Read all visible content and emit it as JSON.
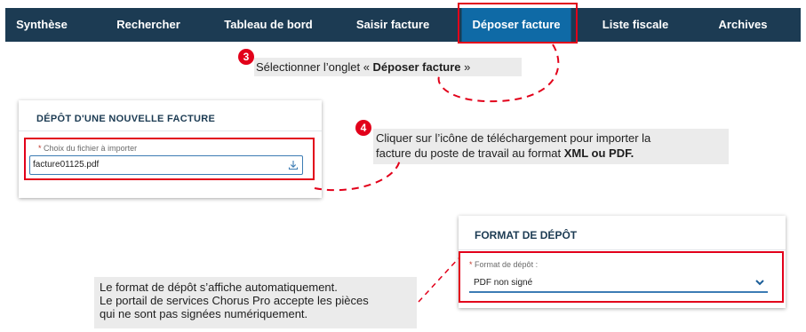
{
  "nav": {
    "tabs": [
      {
        "label": "Synthèse"
      },
      {
        "label": "Rechercher"
      },
      {
        "label": "Tableau de bord"
      },
      {
        "label": "Saisir facture"
      },
      {
        "label": "Déposer facture"
      },
      {
        "label": "Liste fiscale"
      },
      {
        "label": "Archives"
      }
    ],
    "active_tab": "Déposer facture"
  },
  "steps": {
    "step3": {
      "number": "3",
      "text_before": "Sélectionner l’onglet « ",
      "text_bold": "Déposer facture",
      "text_after": " »"
    },
    "step4": {
      "number": "4",
      "line1": "Cliquer sur l’icône de téléchargement pour importer la",
      "line2_before": "facture du poste de travail au format ",
      "line2_bold": "XML ou PDF."
    }
  },
  "upload_panel": {
    "title": "Dépôt d'une nouvelle facture",
    "field_required_mark": "*",
    "field_label": "Choix du fichier à importer",
    "file_value": "facture01125.pdf",
    "icon": "upload-icon"
  },
  "format_panel": {
    "title": "Format de dépôt",
    "field_required_mark": "*",
    "field_label": "Format de dépôt :",
    "selected_value": "PDF non signé",
    "icon": "chevron-down-icon"
  },
  "info": {
    "line1": "Le format de dépôt s’affiche automatiquement.",
    "line2": "Le portail de services Chorus Pro accepte les pièces",
    "line3": "qui ne sont pas signées numériquement."
  },
  "colors": {
    "navbar": "#1c3b53",
    "active_tab": "#0f6aa6",
    "highlight": "#e2001a",
    "panel_title": "#1c3b53",
    "field_border": "#3c7cb4"
  }
}
